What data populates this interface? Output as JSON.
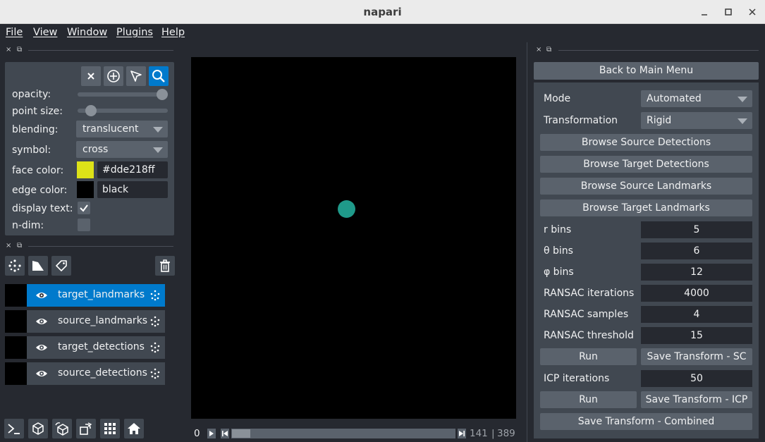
{
  "window": {
    "title": "napari"
  },
  "menu": [
    "File",
    "View",
    "Window",
    "Plugins",
    "Help"
  ],
  "dock": {
    "close_glyph": "×",
    "float_glyph": "⧉"
  },
  "layer_controls": {
    "opacity_label": "opacity:",
    "opacity_value": 1.0,
    "point_size_label": "point size:",
    "point_size_value": 0.1,
    "blending_label": "blending:",
    "blending_value": "translucent",
    "symbol_label": "symbol:",
    "symbol_value": "cross",
    "face_color_label": "face color:",
    "face_color_value": "#dde218ff",
    "face_color_hex": "#dde218",
    "edge_color_label": "edge color:",
    "edge_color_value": "black",
    "edge_color_hex": "#000000",
    "display_text_label": "display text:",
    "display_text_checked": true,
    "ndim_label": "n-dim:",
    "ndim_checked": false,
    "tools": [
      "delete-icon",
      "add-point-icon",
      "select-icon",
      "pan-zoom-icon"
    ],
    "active_tool": "pan-zoom-icon"
  },
  "layer_buttons": [
    "new-points-icon",
    "new-shapes-icon",
    "new-labels-icon",
    "trash-icon"
  ],
  "layers": [
    {
      "name": "target_landmarks",
      "selected": true
    },
    {
      "name": "source_landmarks",
      "selected": false
    },
    {
      "name": "target_detections",
      "selected": false
    },
    {
      "name": "source_detections",
      "selected": false
    }
  ],
  "console_buttons": [
    "console-icon",
    "ndisplay-icon",
    "roll-icon",
    "transpose-icon",
    "grid-icon",
    "home-icon"
  ],
  "canvas": {
    "point_color": "#1f9a8a"
  },
  "dims": {
    "current": "0",
    "value_label": "141",
    "max_label": "389",
    "progress": 0.0
  },
  "plugin": {
    "back_button": "Back to Main Menu",
    "mode_label": "Mode",
    "mode_value": "Automated",
    "transformation_label": "Transformation",
    "transformation_value": "Rigid",
    "browse_source_detections": "Browse Source Detections",
    "browse_target_detections": "Browse Target Detections",
    "browse_source_landmarks": "Browse Source Landmarks",
    "browse_target_landmarks": "Browse Target Landmarks",
    "r_bins_label": "r bins",
    "r_bins_value": "5",
    "theta_bins_label": "θ bins",
    "theta_bins_value": "6",
    "phi_bins_label": "φ bins",
    "phi_bins_value": "12",
    "ransac_iterations_label": "RANSAC iterations",
    "ransac_iterations_value": "4000",
    "ransac_samples_label": "RANSAC samples",
    "ransac_samples_value": "4",
    "ransac_threshold_label": "RANSAC threshold",
    "ransac_threshold_value": "15",
    "run_label": "Run",
    "save_sc_label": "Save Transform - SC",
    "icp_iterations_label": "ICP iterations",
    "icp_iterations_value": "50",
    "run2_label": "Run",
    "save_icp_label": "Save Transform - ICP",
    "save_combined_label": "Save Transform - Combined"
  }
}
